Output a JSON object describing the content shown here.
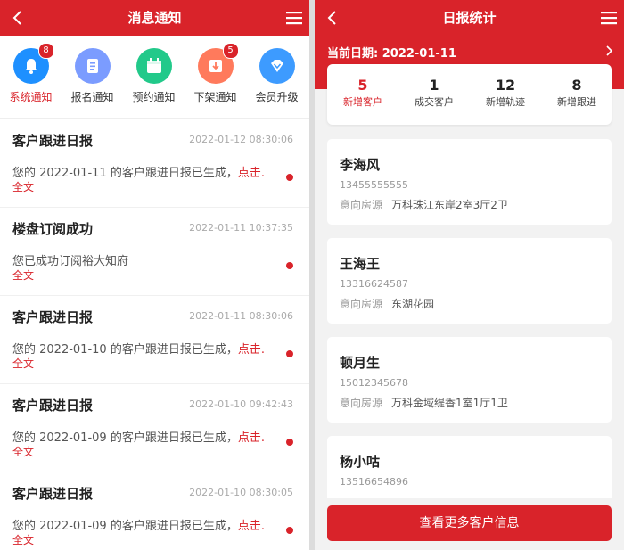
{
  "colors": {
    "brand": "#d9232a",
    "icon_blue": "#1e90ff",
    "icon_purple": "#7b9cff",
    "icon_green": "#22c98a",
    "icon_orange": "#ff7a5c",
    "icon_lightblue": "#3d9bff"
  },
  "left": {
    "title": "消息通知",
    "categories": [
      {
        "label": "系统通知",
        "badge": "8",
        "icon": "bell-icon"
      },
      {
        "label": "报名通知",
        "badge": "",
        "icon": "document-icon"
      },
      {
        "label": "预约通知",
        "badge": "",
        "icon": "calendar-icon"
      },
      {
        "label": "下架通知",
        "badge": "5",
        "icon": "download-icon"
      },
      {
        "label": "会员升级",
        "badge": "",
        "icon": "diamond-icon"
      }
    ],
    "messages": [
      {
        "title": "客户跟进日报",
        "time": "2022-01-12 08:30:06",
        "body": "您的 2022-01-11 的客户跟进日报已生成，",
        "more": "点击.",
        "full": "全文"
      },
      {
        "title": "楼盘订阅成功",
        "time": "2022-01-11 10:37:35",
        "body": "您已成功订阅裕大知府",
        "more": "",
        "full": "全文"
      },
      {
        "title": "客户跟进日报",
        "time": "2022-01-11 08:30:06",
        "body": "您的 2022-01-10 的客户跟进日报已生成，",
        "more": "点击.",
        "full": "全文"
      },
      {
        "title": "客户跟进日报",
        "time": "2022-01-10 09:42:43",
        "body": "您的 2022-01-09 的客户跟进日报已生成，",
        "more": "点击.",
        "full": "全文"
      },
      {
        "title": "客户跟进日报",
        "time": "2022-01-10 08:30:05",
        "body": "您的 2022-01-09 的客户跟进日报已生成，",
        "more": "点击.",
        "full": "全文"
      }
    ]
  },
  "right": {
    "title": "日报统计",
    "date_label": "当前日期: 2022-01-11",
    "stats": [
      {
        "num": "5",
        "label": "新增客户"
      },
      {
        "num": "1",
        "label": "成交客户"
      },
      {
        "num": "12",
        "label": "新增轨迹"
      },
      {
        "num": "8",
        "label": "新增跟进"
      }
    ],
    "intent_label": "意向房源",
    "customers": [
      {
        "name": "李海风",
        "phone": "13455555555",
        "intent": "万科珠江东岸2室3厅2卫"
      },
      {
        "name": "王海王",
        "phone": "13316624587",
        "intent": "东湖花园"
      },
      {
        "name": "顿月生",
        "phone": "15012345678",
        "intent": "万科金域缇香1室1厅1卫"
      },
      {
        "name": "杨小咕",
        "phone": "13516654896",
        "intent": ""
      }
    ],
    "more_button": "查看更多客户信息"
  }
}
